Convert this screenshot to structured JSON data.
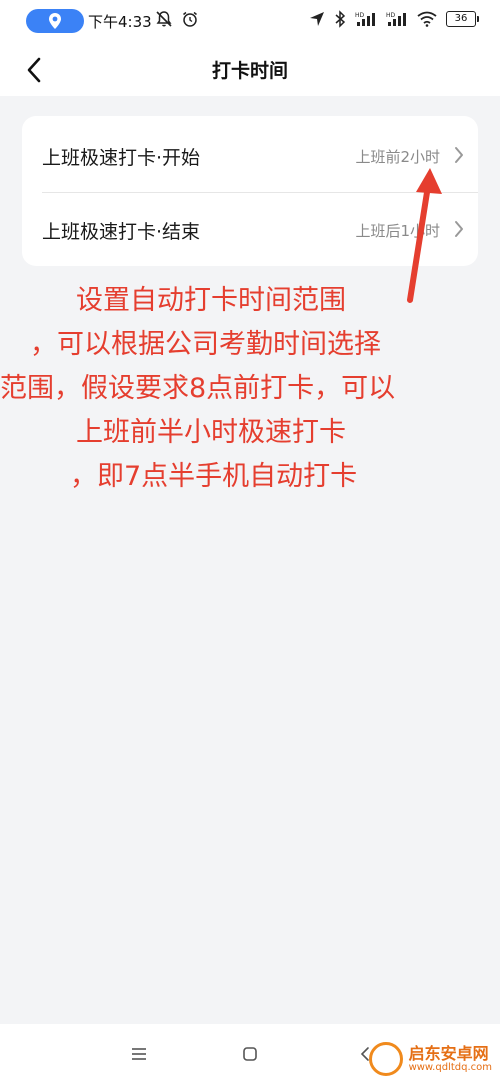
{
  "status_bar": {
    "time": "下午4:33",
    "battery": "36",
    "icons": [
      "location-icon",
      "mute-icon",
      "alarm-icon",
      "navigation-icon",
      "bluetooth-icon",
      "signal-hd-icon",
      "signal-hd-icon",
      "wifi-icon",
      "battery-icon"
    ]
  },
  "nav": {
    "title": "打卡时间",
    "back_icon": "chevron-left-icon"
  },
  "settings": {
    "rows": [
      {
        "label": "上班极速打卡·开始",
        "value": "上班前2小时"
      },
      {
        "label": "上班极速打卡·结束",
        "value": "上班后1小时"
      }
    ]
  },
  "annotation": {
    "color": "#e53e2f",
    "lines": [
      "设置自动打卡时间范围",
      "，可以根据公司考勤时间选择",
      "范围，假设要求8点前打卡，可以",
      "上班前半小时极速打卡",
      "，即7点半手机自动打卡"
    ]
  },
  "bottom_nav": {
    "icons": [
      "menu-icon",
      "home-icon",
      "back-icon"
    ]
  },
  "watermark": {
    "name": "启东安卓网",
    "url": "www.qdltdq.com"
  },
  "colors": {
    "accent": "#3b82f6",
    "background": "#f3f4f6",
    "annotation": "#e53e2f",
    "watermark": "#e56f15"
  }
}
